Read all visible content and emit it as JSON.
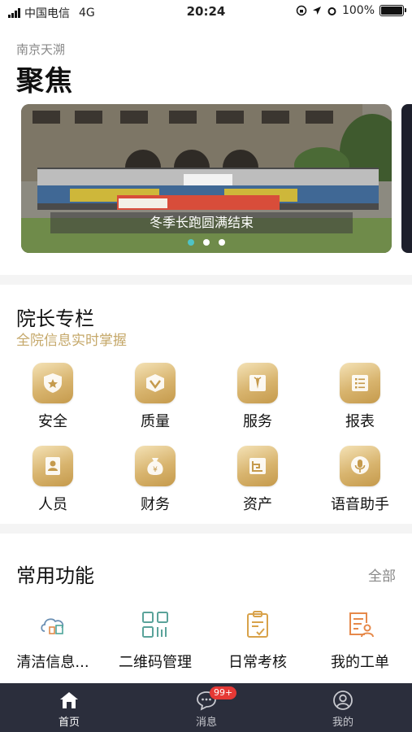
{
  "status_bar": {
    "carrier": "中国电信",
    "network": "4G",
    "time": "20:24",
    "battery": "100%",
    "battery_level": 1.0
  },
  "header": {
    "subtitle": "南京天溯",
    "title": "聚焦"
  },
  "banner": {
    "caption": "冬季长跑圆满结束",
    "slide_count": 3,
    "active_slide": 1
  },
  "dean_column": {
    "title": "院长专栏",
    "subtitle": "全院信息实时掌握",
    "items": [
      {
        "label": "安全",
        "icon": "shield-icon"
      },
      {
        "label": "质量",
        "icon": "quality-icon"
      },
      {
        "label": "服务",
        "icon": "service-icon"
      },
      {
        "label": "报表",
        "icon": "report-icon"
      },
      {
        "label": "人员",
        "icon": "personnel-icon"
      },
      {
        "label": "财务",
        "icon": "money-bag-icon"
      },
      {
        "label": "资产",
        "icon": "asset-icon"
      },
      {
        "label": "语音助手",
        "icon": "microphone-icon"
      }
    ]
  },
  "common_functions": {
    "title": "常用功能",
    "more_label": "全部",
    "items": [
      {
        "label": "清洁信息...",
        "icon": "cloud-data-icon"
      },
      {
        "label": "二维码管理",
        "icon": "qrcode-icon"
      },
      {
        "label": "日常考核",
        "icon": "clipboard-check-icon"
      },
      {
        "label": "我的工单",
        "icon": "work-order-icon"
      }
    ]
  },
  "tabbar": {
    "tabs": [
      {
        "label": "首页",
        "icon": "home-icon",
        "active": true
      },
      {
        "label": "消息",
        "icon": "message-icon",
        "badge": "99+"
      },
      {
        "label": "我的",
        "icon": "profile-icon"
      }
    ]
  },
  "colors": {
    "accent_gold": "#c5a86a",
    "tabbar_bg": "#2b2e3c",
    "badge_red": "#e53935",
    "dot_active": "#4fc3c7"
  }
}
